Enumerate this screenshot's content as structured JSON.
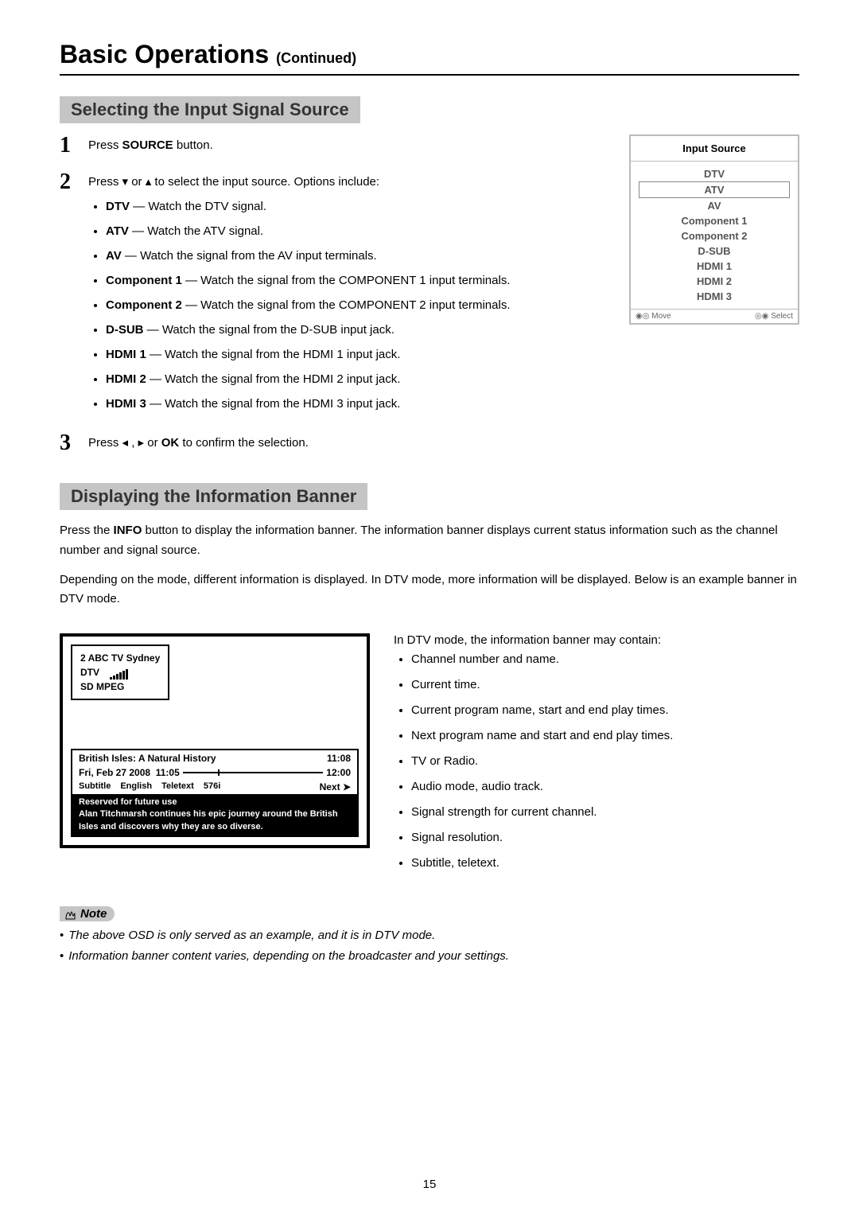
{
  "header": {
    "title": "Basic Operations",
    "suffix": "(Continued)"
  },
  "section1": {
    "title": "Selecting the Input Signal Source",
    "step1": {
      "prefix": "Press ",
      "bold": "SOURCE",
      "suffix": " button."
    },
    "step2": {
      "text": "Press ▾ or ▴ to select the input source. Options include:"
    },
    "options": [
      {
        "name": "DTV",
        "desc": " — Watch the DTV signal."
      },
      {
        "name": "ATV",
        "desc": " — Watch the ATV signal."
      },
      {
        "name": "AV",
        "desc": " — Watch the signal from the AV input terminals."
      },
      {
        "name": "Component 1",
        "desc": " — Watch the signal from the COMPONENT 1 input terminals."
      },
      {
        "name": "Component 2",
        "desc": " — Watch the signal from the COMPONENT 2 input terminals."
      },
      {
        "name": "D-SUB",
        "desc": " — Watch the signal from the D-SUB input jack."
      },
      {
        "name": "HDMI 1",
        "desc": " — Watch the signal from the HDMI 1 input jack."
      },
      {
        "name": "HDMI 2",
        "desc": " — Watch the signal from the HDMI 2 input jack."
      },
      {
        "name": "HDMI 3",
        "desc": " — Watch the signal from the HDMI 3 input jack."
      }
    ],
    "step3": {
      "prefix": "Press  ◂ , ▸  or ",
      "bold": "OK",
      "suffix": " to confirm the selection."
    }
  },
  "osd": {
    "title": "Input Source",
    "items": [
      "DTV",
      "ATV",
      "AV",
      "Component 1",
      "Component 2",
      "D-SUB",
      "HDMI 1",
      "HDMI 2",
      "HDMI 3"
    ],
    "move": "Move",
    "select": "Select"
  },
  "section2": {
    "title": "Displaying the Information Banner",
    "p1a": "Press the ",
    "p1b": "INFO",
    "p1c": " button to display the information banner. The information banner displays current status information such as the channel number and signal source.",
    "p2": "Depending on the mode, different information is displayed. In DTV mode, more information will be displayed. Below is an example banner in DTV mode."
  },
  "banner": {
    "ch": "2  ABC TV Sydney",
    "mode": "DTV",
    "sdmpeg": "SD  MPEG",
    "prog": "British Isles: A Natural History",
    "end": "11:08",
    "date": "Fri, Feb 27 2008",
    "now": "11:05",
    "end2": "12:00",
    "sub": "Subtitle",
    "lang": "English",
    "ttx": "Teletext",
    "res": "576i",
    "next": "Next ➤",
    "reserved": "Reserved for future use",
    "desc": "Alan Titchmarsh continues his epic journey around the British Isles and discovers why they are so diverse."
  },
  "infolist": {
    "lead": "In DTV mode, the information banner may contain:",
    "items": [
      "Channel number and name.",
      "Current time.",
      "Current program name, start and end play times.",
      "Next program name and start and end play times.",
      "TV or Radio.",
      "Audio mode, audio track.",
      "Signal strength for current channel.",
      "Signal resolution.",
      "Subtitle, teletext."
    ]
  },
  "note": {
    "label": "Note",
    "items": [
      "The above OSD is only served as an example, and it is in DTV mode.",
      "Information banner content varies, depending on the broadcaster and your settings."
    ]
  },
  "page_number": "15"
}
